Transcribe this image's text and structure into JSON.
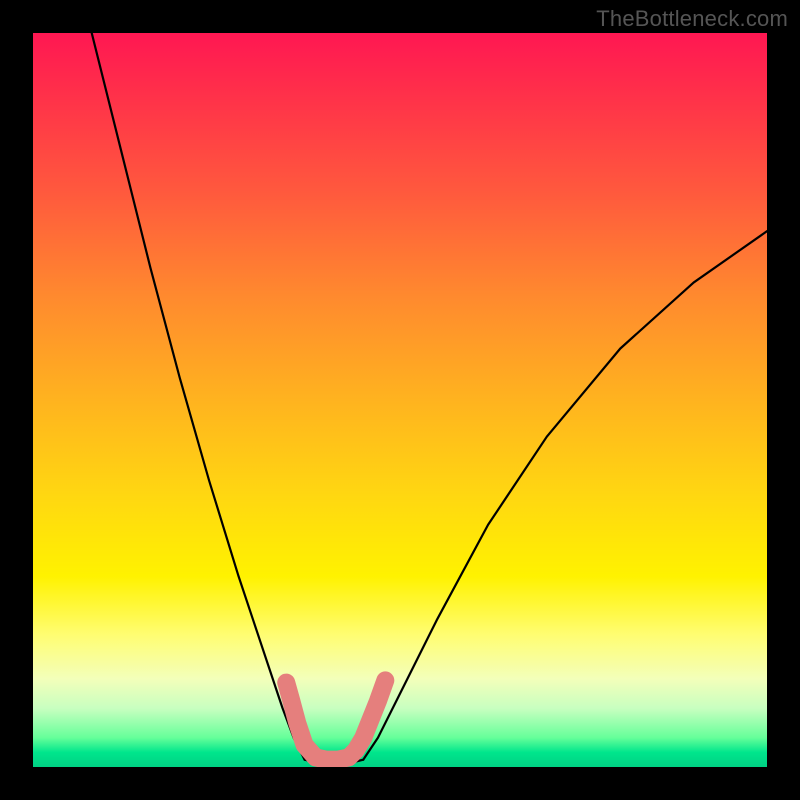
{
  "watermark": {
    "text": "TheBottleneck.com"
  },
  "chart_data": {
    "type": "line",
    "title": "",
    "xlabel": "",
    "ylabel": "",
    "xlim": [
      0,
      100
    ],
    "ylim": [
      0,
      100
    ],
    "series": [
      {
        "name": "left-curve",
        "x": [
          8,
          12,
          16,
          20,
          24,
          28,
          30,
          32,
          34,
          35.5,
          37
        ],
        "values": [
          100,
          84,
          68,
          53,
          39,
          26,
          20,
          14,
          8,
          4,
          1
        ]
      },
      {
        "name": "bottom-flat",
        "x": [
          37,
          39,
          41,
          43,
          45
        ],
        "values": [
          1,
          0.5,
          0.5,
          0.5,
          1
        ]
      },
      {
        "name": "right-curve",
        "x": [
          45,
          47,
          50,
          55,
          62,
          70,
          80,
          90,
          100
        ],
        "values": [
          1,
          4,
          10,
          20,
          33,
          45,
          57,
          66,
          73
        ]
      },
      {
        "name": "worm-overlay",
        "x": [
          34.5,
          35.2,
          36,
          37,
          38.5,
          40,
          41.5,
          43,
          44,
          45,
          46,
          47,
          48
        ],
        "values": [
          11.5,
          9,
          6,
          3,
          1.3,
          1,
          1,
          1.3,
          2.3,
          4,
          6.5,
          9,
          11.8
        ]
      }
    ],
    "styles": {
      "left-curve": {
        "stroke": "#000000",
        "width": 2.2,
        "cap": "round"
      },
      "bottom-flat": {
        "stroke": "#000000",
        "width": 2.2,
        "cap": "round"
      },
      "right-curve": {
        "stroke": "#000000",
        "width": 2.2,
        "cap": "round"
      },
      "worm-overlay": {
        "stroke": "#e57f7d",
        "width": 18,
        "cap": "round"
      }
    },
    "background_gradient_note": "red(top)→orange→yellow→pale→green(bottom)"
  }
}
